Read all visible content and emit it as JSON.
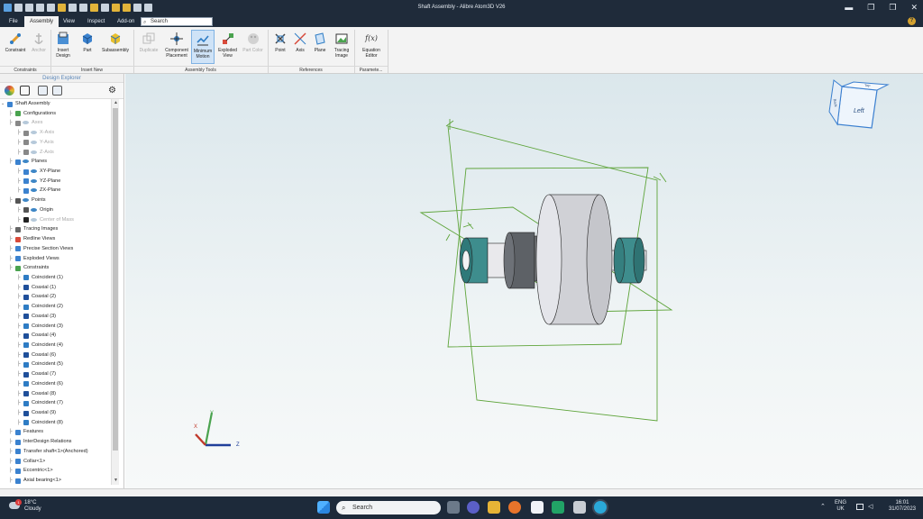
{
  "window": {
    "title": "Shaft Assembly - Alibre Atom3D V26",
    "controls": [
      "▬",
      "❐",
      "❒",
      "✕"
    ]
  },
  "menu": {
    "tabs": [
      "File",
      "Assembly",
      "View",
      "Inspect",
      "Add-on"
    ],
    "active_tab": "Assembly",
    "search_placeholder": "Search",
    "help": "?"
  },
  "ribbon": {
    "buttons": [
      {
        "label": "Constraint",
        "state": "normal"
      },
      {
        "label": "Anchor",
        "state": "disabled"
      },
      {
        "label": "Insert Design",
        "state": "normal"
      },
      {
        "label": "Part",
        "state": "normal"
      },
      {
        "label": "Subassembly",
        "state": "normal"
      },
      {
        "label": "Duplicate",
        "state": "disabled"
      },
      {
        "label": "Component Placement",
        "state": "normal"
      },
      {
        "label": "Minimum Motion",
        "state": "selected"
      },
      {
        "label": "Exploded View",
        "state": "normal"
      },
      {
        "label": "Part Color",
        "state": "disabled"
      },
      {
        "label": "Point",
        "state": "normal"
      },
      {
        "label": "Axis",
        "state": "normal"
      },
      {
        "label": "Plane",
        "state": "normal"
      },
      {
        "label": "Tracing Image",
        "state": "normal"
      },
      {
        "label": "Equation Editor",
        "state": "normal"
      }
    ],
    "groups": [
      "Constraints",
      "Insert New",
      "Assembly Tools",
      "References",
      "Paramete..."
    ],
    "equation_glyph": "f(x)"
  },
  "explorer": {
    "title": "Design Explorer",
    "tree": [
      {
        "label": "Shaft Assembly",
        "level": 0,
        "grey": false
      },
      {
        "label": "Configurations",
        "level": 1,
        "grey": false
      },
      {
        "label": "Axes",
        "level": 1,
        "grey": true
      },
      {
        "label": "X-Axis",
        "level": 2,
        "grey": true
      },
      {
        "label": "Y-Axis",
        "level": 2,
        "grey": true
      },
      {
        "label": "Z-Axis",
        "level": 2,
        "grey": true
      },
      {
        "label": "Planes",
        "level": 1,
        "grey": false
      },
      {
        "label": "XY-Plane",
        "level": 2,
        "grey": false
      },
      {
        "label": "YZ-Plane",
        "level": 2,
        "grey": false
      },
      {
        "label": "ZX-Plane",
        "level": 2,
        "grey": false
      },
      {
        "label": "Points",
        "level": 1,
        "grey": false
      },
      {
        "label": "Origin",
        "level": 2,
        "grey": false
      },
      {
        "label": "Center of Mass",
        "level": 2,
        "grey": true
      },
      {
        "label": "Tracing Images",
        "level": 1,
        "grey": false
      },
      {
        "label": "Redline Views",
        "level": 1,
        "grey": false
      },
      {
        "label": "Precise Section Views",
        "level": 1,
        "grey": false
      },
      {
        "label": "Exploded Views",
        "level": 1,
        "grey": false
      },
      {
        "label": "Constraints",
        "level": 1,
        "grey": false
      },
      {
        "label": "Coincident (1)",
        "level": 2,
        "grey": false
      },
      {
        "label": "Coaxial (1)",
        "level": 2,
        "grey": false
      },
      {
        "label": "Coaxial (2)",
        "level": 2,
        "grey": false
      },
      {
        "label": "Coincident (2)",
        "level": 2,
        "grey": false
      },
      {
        "label": "Coaxial (3)",
        "level": 2,
        "grey": false
      },
      {
        "label": "Coincident (3)",
        "level": 2,
        "grey": false
      },
      {
        "label": "Coaxial (4)",
        "level": 2,
        "grey": false
      },
      {
        "label": "Coincident (4)",
        "level": 2,
        "grey": false
      },
      {
        "label": "Coaxial (6)",
        "level": 2,
        "grey": false
      },
      {
        "label": "Coincident (5)",
        "level": 2,
        "grey": false
      },
      {
        "label": "Coaxial (7)",
        "level": 2,
        "grey": false
      },
      {
        "label": "Coincident (6)",
        "level": 2,
        "grey": false
      },
      {
        "label": "Coaxial (8)",
        "level": 2,
        "grey": false
      },
      {
        "label": "Coincident (7)",
        "level": 2,
        "grey": false
      },
      {
        "label": "Coaxial (9)",
        "level": 2,
        "grey": false
      },
      {
        "label": "Coincident (8)",
        "level": 2,
        "grey": false
      },
      {
        "label": "Features",
        "level": 1,
        "grey": false
      },
      {
        "label": "InterDesign Relations",
        "level": 1,
        "grey": false
      },
      {
        "label": "Transfer shaft<1>(Anchored)",
        "level": 1,
        "grey": false
      },
      {
        "label": "Collar<1>",
        "level": 1,
        "grey": false
      },
      {
        "label": "Eccentric<1>",
        "level": 1,
        "grey": false
      },
      {
        "label": "Axial bearing<1>",
        "level": 1,
        "grey": false
      }
    ]
  },
  "viewport": {
    "view_cube": {
      "face": "Left",
      "top": "Top",
      "side": "Back"
    },
    "triad": {
      "x": "X",
      "y": "Y",
      "z": "Z"
    }
  },
  "taskbar": {
    "weather_temp": "18°C",
    "weather_desc": "Cloudy",
    "weather_badge": "1",
    "search_placeholder": "Search",
    "lang": "ENG",
    "region": "UK",
    "time": "16:01",
    "date": "31/07/2023"
  }
}
